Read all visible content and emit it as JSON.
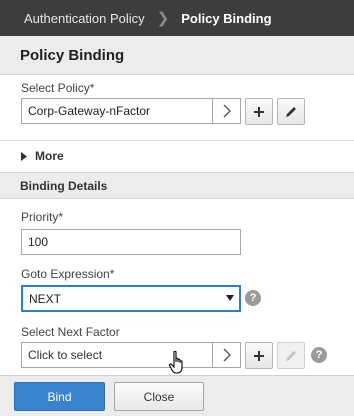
{
  "breadcrumb": {
    "parent": "Authentication Policy",
    "current": "Policy Binding"
  },
  "header": {
    "title": "Policy Binding"
  },
  "select_policy": {
    "label": "Select Policy*",
    "value": "Corp-Gateway-nFactor"
  },
  "more": {
    "label": "More"
  },
  "binding_details": {
    "title": "Binding Details"
  },
  "priority": {
    "label": "Priority*",
    "value": "100"
  },
  "goto_expression": {
    "label": "Goto Expression*",
    "selected": "NEXT"
  },
  "next_factor": {
    "label": "Select Next Factor",
    "placeholder": "Click to select"
  },
  "footer": {
    "bind_label": "Bind",
    "close_label": "Close"
  },
  "colors": {
    "breadcrumb_bg": "#3d3d3d",
    "primary": "#3a84cf",
    "focus_border": "#2a7fd2"
  },
  "icons": [
    "chevron-right-icon",
    "plus-icon",
    "pencil-icon",
    "caret-right-icon",
    "caret-down-icon",
    "help-icon",
    "hand-cursor-icon"
  ]
}
